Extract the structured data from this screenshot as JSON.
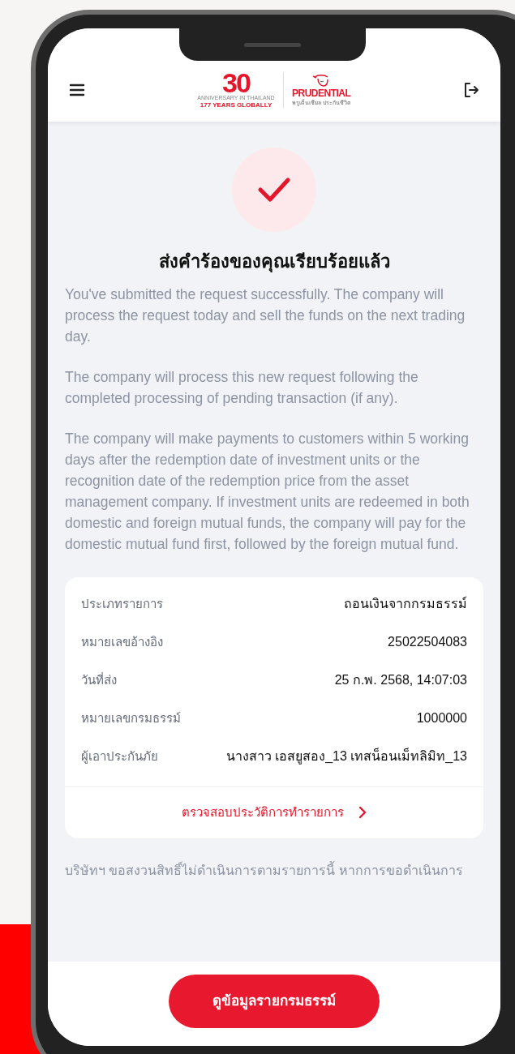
{
  "header": {
    "logo": {
      "number": "30",
      "anniversary": "ANNIVERSARY IN THAILAND",
      "years": "177 YEARS GLOBALLY",
      "brand": "PRUDENTIAL",
      "brand_thai": "พรูเด็นเชียล ประกันชีวิต"
    }
  },
  "title": "ส่งคำร้องของคุณเรียบร้อยแล้ว",
  "paragraphs": [
    "You've submitted the request successfully. The company will process the request today and sell the funds on the next trading day.",
    "The company will process this new request following the completed processing of pending transaction (if any).",
    "The company will make payments to customers within 5 working days after the redemption date of investment units or the recognition date of the redemption price from the asset management company. If investment units are redeemed in both domestic and foreign mutual funds, the company will pay for the domestic mutual fund first, followed by the foreign mutual fund."
  ],
  "details": [
    {
      "label": "ประเภทรายการ",
      "value": "ถอนเงินจากกรมธรรม์"
    },
    {
      "label": "หมายเลขอ้างอิง",
      "value": "25022504083"
    },
    {
      "label": "วันที่ส่ง",
      "value": "25 ก.พ. 2568, 14:07:03"
    },
    {
      "label": "หมายเลขกรมธรรม์",
      "value": "1000000"
    },
    {
      "label": "ผู้เอาประกันภัย",
      "value": "นางสาว เอสยูสอง_13 เทสน็อนเม็ทลิมิท_13"
    }
  ],
  "history_link": "ตรวจสอบประวัติการทำรายการ",
  "note": "บริษัทฯ ขอสงวนสิทธิ์ไม่ดำเนินการตามรายการนี้ หากการขอดำเนินการ",
  "primary_button": "ดูข้อมูลรายกรมธรรม์"
}
